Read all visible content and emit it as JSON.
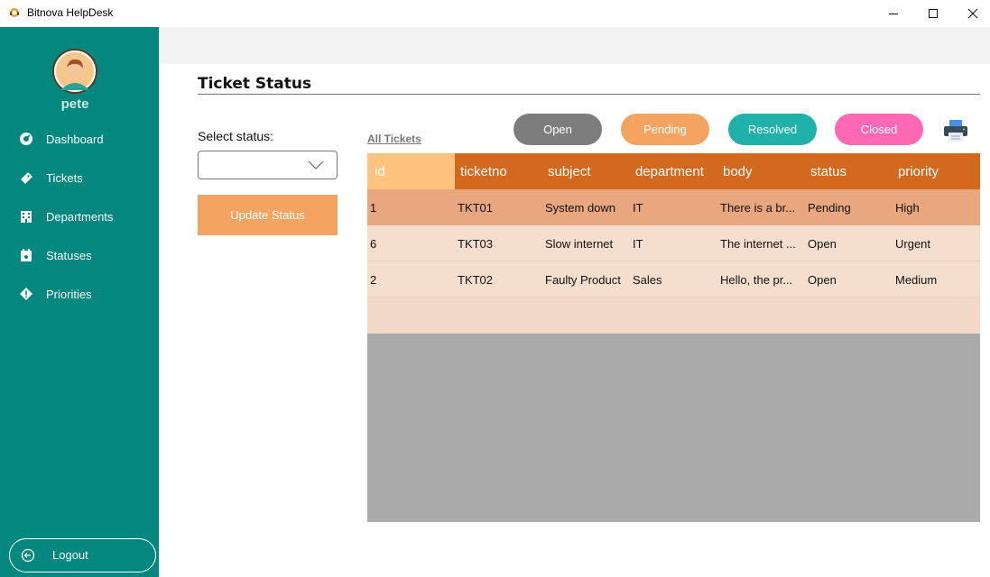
{
  "window": {
    "title": "Bitnova HelpDesk"
  },
  "user": {
    "name": "pete"
  },
  "sidebar": {
    "items": [
      {
        "label": "Dashboard",
        "icon": "dashboard-icon"
      },
      {
        "label": "Tickets",
        "icon": "ticket-icon"
      },
      {
        "label": "Departments",
        "icon": "building-icon"
      },
      {
        "label": "Statuses",
        "icon": "calendar-icon"
      },
      {
        "label": "Priorities",
        "icon": "alert-diamond-icon"
      }
    ],
    "logout_label": "Logout"
  },
  "page": {
    "title": "Ticket Status"
  },
  "form": {
    "select_label": "Select status:",
    "select_value": "",
    "update_label": "Update Status"
  },
  "filters": {
    "all_tickets": "All Tickets",
    "open": "Open",
    "pending": "Pending",
    "resolved": "Resolved",
    "closed": "Closed"
  },
  "colors": {
    "sidebar": "#03877f",
    "header": "#d2691e",
    "open": "#7d7d7d",
    "pending": "#f4a460",
    "resolved": "#20b2aa",
    "closed": "#ff69b4"
  },
  "table": {
    "columns": [
      "id",
      "ticketno",
      "subject",
      "department",
      "body",
      "status",
      "priority"
    ],
    "rows": [
      [
        "1",
        "TKT01",
        "System down",
        "IT",
        "There is a br...",
        "Pending",
        "High"
      ],
      [
        "6",
        "TKT03",
        "Slow internet",
        "IT",
        "The internet ...",
        "Open",
        "Urgent"
      ],
      [
        "2",
        "TKT02",
        "Faulty Product",
        "Sales",
        "Hello, the pr...",
        "Open",
        "Medium"
      ]
    ]
  }
}
